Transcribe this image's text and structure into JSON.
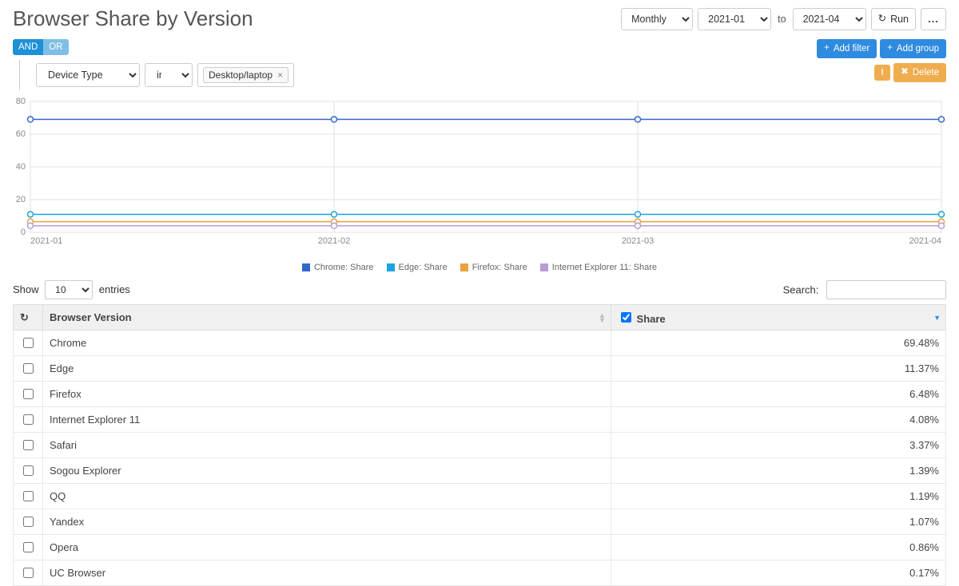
{
  "page_title": "Browser Share by Version",
  "header": {
    "period_select": "Monthly",
    "period_options": [
      "Monthly"
    ],
    "from": "2021-01",
    "to_label": "to",
    "to": "2021-04",
    "run_label": "Run",
    "more_label": "..."
  },
  "filters": {
    "and_label": "AND",
    "or_label": "OR",
    "dimension": "Device Type",
    "operator": "in",
    "chip_value": "Desktop/laptop",
    "add_filter_label": "Add filter",
    "add_group_label": "Add group",
    "delete_label": "Delete"
  },
  "chart_data": {
    "type": "line",
    "x": [
      "2021-01",
      "2021-02",
      "2021-03",
      "2021-04"
    ],
    "ylim": [
      0,
      80
    ],
    "yticks": [
      0,
      20,
      40,
      60,
      80
    ],
    "series": [
      {
        "name": "Chrome: Share",
        "color": "#3366cc",
        "values": [
          69,
          69,
          69,
          69
        ]
      },
      {
        "name": "Edge: Share",
        "color": "#1aa3df",
        "values": [
          11,
          11,
          11,
          11
        ]
      },
      {
        "name": "Firefox: Share",
        "color": "#e8a33d",
        "values": [
          6.5,
          6.5,
          6.5,
          6.5
        ]
      },
      {
        "name": "Internet Explorer 11: Share",
        "color": "#b99bd6",
        "values": [
          4,
          4,
          4,
          4
        ]
      }
    ]
  },
  "table": {
    "show_label": "Show",
    "entries_label": "entries",
    "length": "10",
    "search_label": "Search:",
    "search_value": "",
    "col_browser": "Browser Version",
    "col_share": "Share",
    "rows": [
      {
        "browser": "Chrome",
        "share": "69.48%"
      },
      {
        "browser": "Edge",
        "share": "11.37%"
      },
      {
        "browser": "Firefox",
        "share": "6.48%"
      },
      {
        "browser": "Internet Explorer 11",
        "share": "4.08%"
      },
      {
        "browser": "Safari",
        "share": "3.37%"
      },
      {
        "browser": "Sogou Explorer",
        "share": "1.39%"
      },
      {
        "browser": "QQ",
        "share": "1.19%"
      },
      {
        "browser": "Yandex",
        "share": "1.07%"
      },
      {
        "browser": "Opera",
        "share": "0.86%"
      },
      {
        "browser": "UC Browser",
        "share": "0.17%"
      }
    ]
  }
}
